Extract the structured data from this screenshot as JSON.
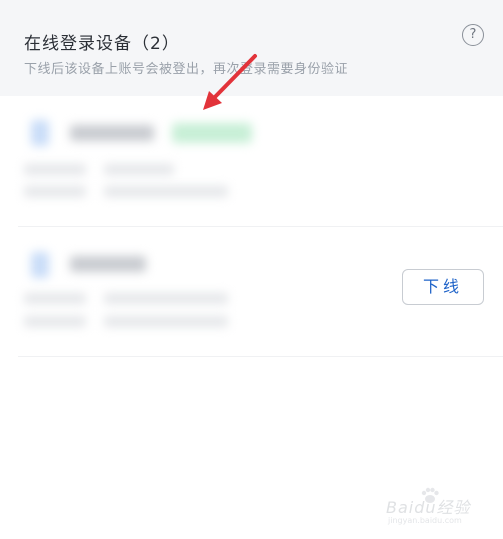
{
  "header": {
    "title": "在线登录设备（2）",
    "subtitle": "下线后该设备上账号会被登出，再次登录需要身份验证",
    "help_glyph": "?",
    "help_icon": "question-circle-icon"
  },
  "devices": [
    {
      "icon": "phone-icon",
      "name": "",
      "badge": "",
      "meta": [
        "",
        ""
      ]
    },
    {
      "icon": "phone-icon",
      "name": "",
      "meta": [
        "",
        ""
      ],
      "action_label": "下线"
    }
  ],
  "annotation": {
    "arrow_color": "#e2333a"
  },
  "watermark": {
    "brand": "Baidu",
    "brand_suffix": "经验",
    "url": "jingyan.baidu.com"
  },
  "colors": {
    "accent": "#1f63c8",
    "header_bg": "#f5f6f8"
  }
}
